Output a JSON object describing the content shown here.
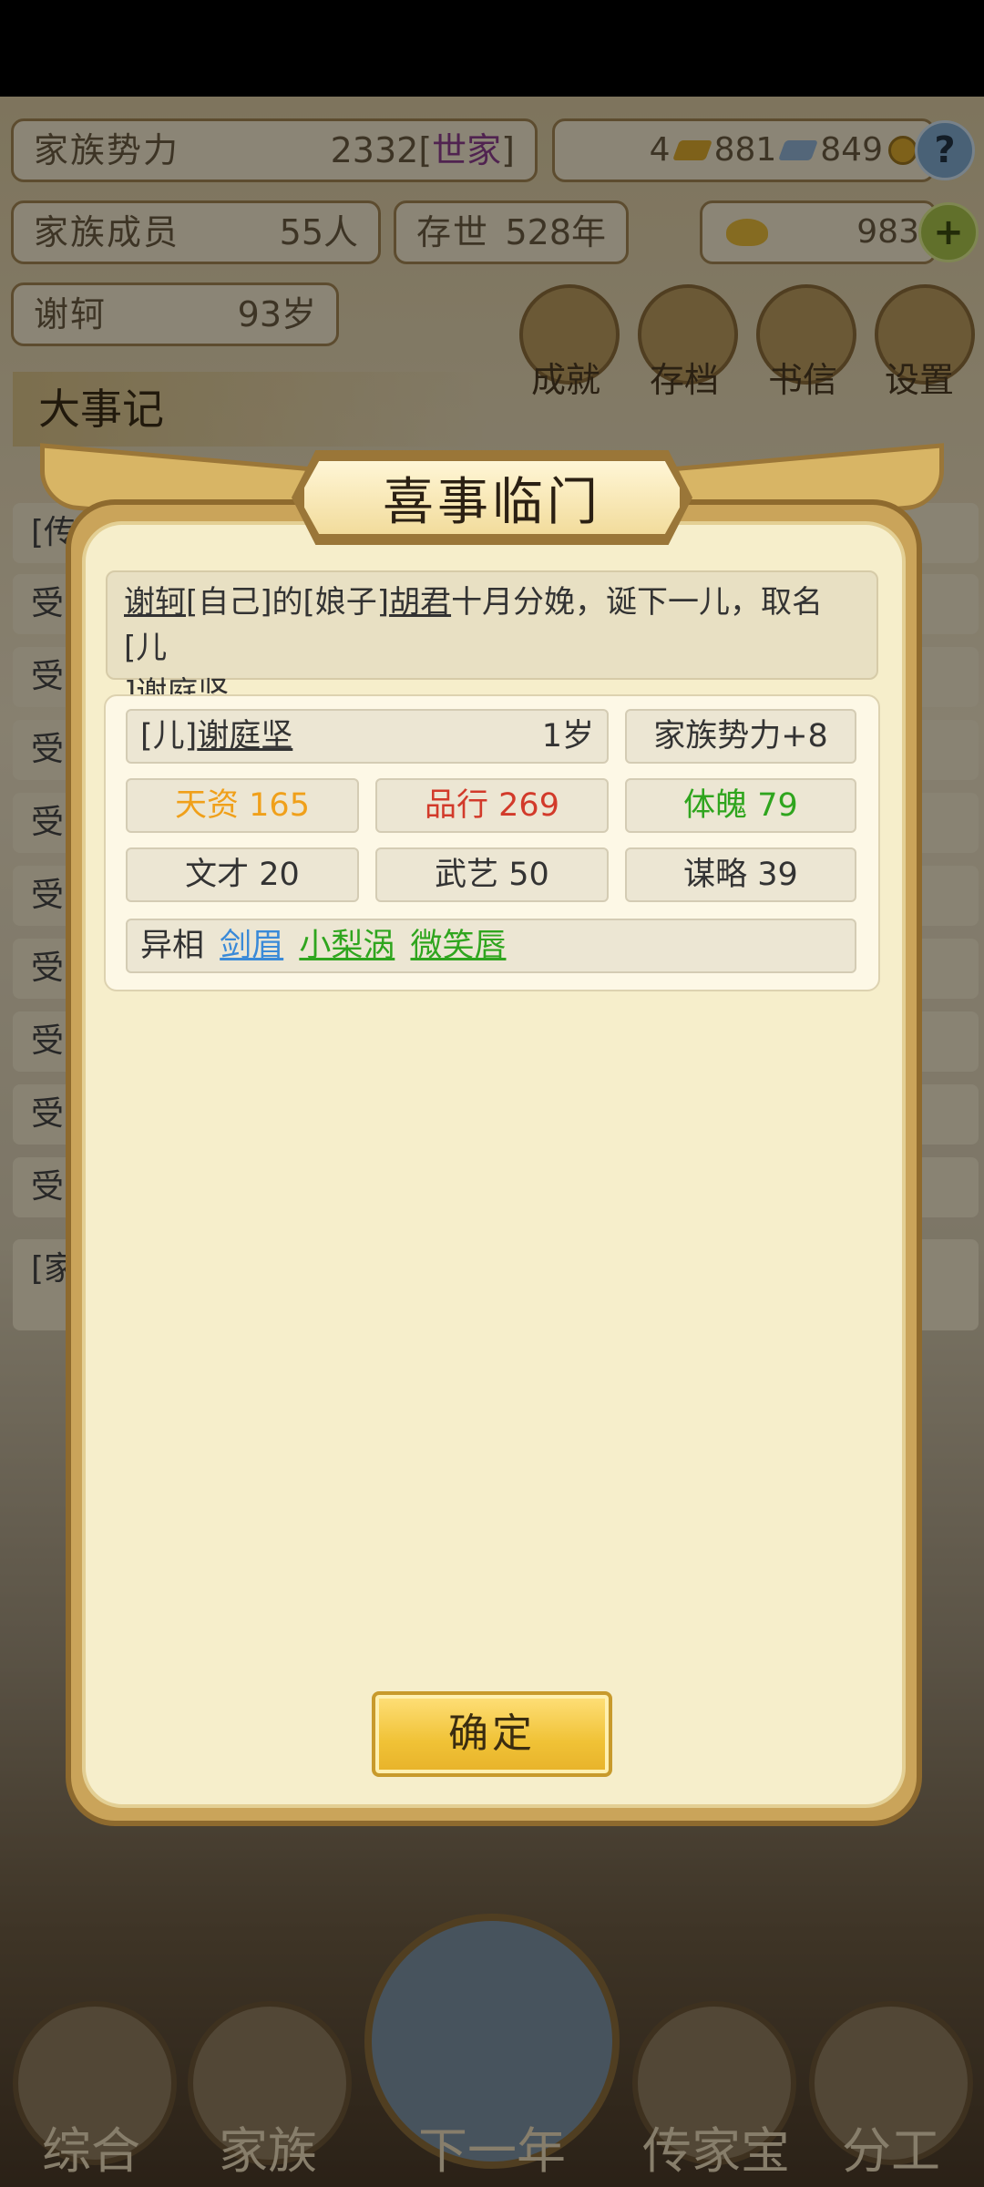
{
  "hud": {
    "clan_power_label": "家族势力",
    "clan_power_value": "2332",
    "clan_power_bracket_open": "[",
    "clan_power_tag": "世家",
    "clan_power_bracket_close": "]",
    "gold_count": "4",
    "copper_count": "881",
    "silver_count": "849",
    "clan_members_label": "家族成员",
    "clan_members_value": "55人",
    "exist_label": "存世",
    "exist_value": "528年",
    "ingot_count": "983",
    "leader_name": "谢轲",
    "leader_age": "93岁"
  },
  "menu": [
    {
      "label": "成就",
      "icon": "achievement-icon"
    },
    {
      "label": "存档",
      "icon": "save-icon"
    },
    {
      "label": "书信",
      "icon": "letter-icon"
    },
    {
      "label": "设置",
      "icon": "settings-icon"
    }
  ],
  "events_title": "大事记",
  "bg_rows": [
    {
      "text": "[传"
    },
    {
      "text": "受"
    },
    {
      "text": "受"
    },
    {
      "text": "受"
    },
    {
      "text": "受"
    },
    {
      "text": "受"
    },
    {
      "text": "受"
    },
    {
      "text": "受"
    },
    {
      "text": "受"
    },
    {
      "text": "受"
    },
    {
      "text": "[家"
    }
  ],
  "modal": {
    "title": "喜事临门",
    "message": {
      "parent": "谢轲",
      "rel1": "[自己]的[娘子]",
      "mother": "胡君",
      "mid": "十月分娩，诞下一儿，取名[儿",
      "rel2": "]",
      "child": "谢庭坚",
      "end": "。"
    },
    "child_rel": "[儿]",
    "child_name": "谢庭坚",
    "child_age": "1岁",
    "power_bonus": "家族势力+8",
    "stats": {
      "talent": "天资 165",
      "morality": "品行 269",
      "physique": "体魄 79",
      "literary": "文才 20",
      "martial": "武艺 50",
      "strategy": "谋略 39"
    },
    "traits_label": "异相",
    "traits": [
      "剑眉",
      "小梨涡",
      "微笑唇"
    ],
    "confirm_label": "确定"
  },
  "nav": [
    {
      "label": "综合"
    },
    {
      "label": "家族"
    },
    {
      "label": "下一年"
    },
    {
      "label": "传家宝"
    },
    {
      "label": "分工"
    }
  ],
  "colors": {
    "modal_bg": "#f6eecb",
    "frame_gold": "#caa45a",
    "talent_orange": "#f0a01a",
    "morality_red": "#d23a2a",
    "physique_green": "#2fa51e",
    "trait_blue": "#3a8ad8"
  }
}
